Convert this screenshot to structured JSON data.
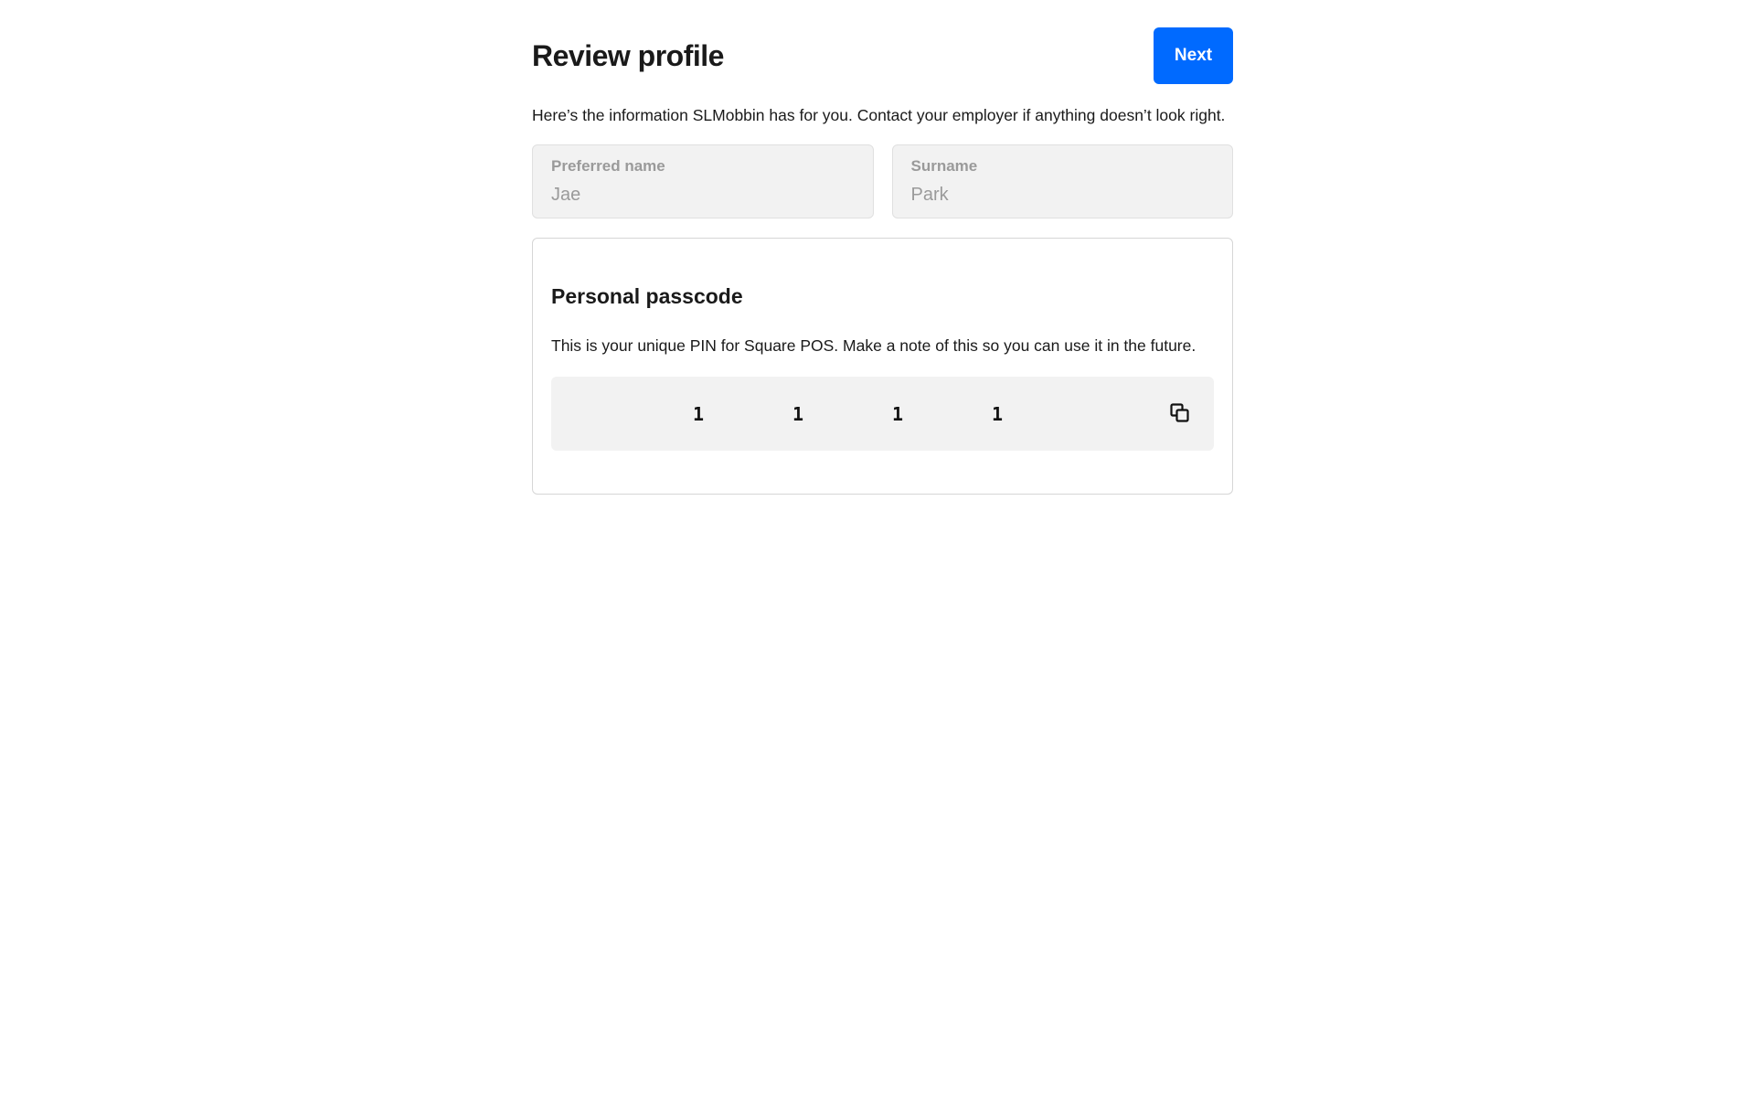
{
  "header": {
    "title": "Review profile",
    "next_label": "Next"
  },
  "intro": "Here’s the information SLMobbin has for you. Contact your employer if anything doesn’t look right.",
  "fields": {
    "preferred_name": {
      "label": "Preferred name",
      "value": "Jae"
    },
    "surname": {
      "label": "Surname",
      "value": "Park"
    }
  },
  "passcode": {
    "title": "Personal passcode",
    "description": "This is your unique PIN for Square POS. Make a note of this so you can use it in the future.",
    "digits": [
      "1",
      "1",
      "1",
      "1"
    ],
    "copy_icon": "copy-icon"
  },
  "colors": {
    "accent": "#006aff",
    "field_bg": "#f2f2f2",
    "muted_text": "#9a9a9a"
  }
}
